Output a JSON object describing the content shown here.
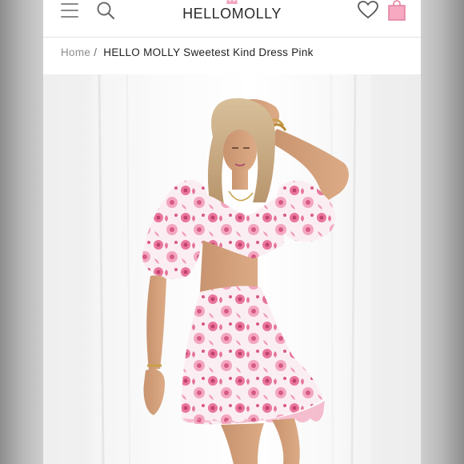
{
  "header": {
    "logo_text": "HELLOMOLLY",
    "icons": [
      "menu-icon",
      "search-icon",
      "crown-icon",
      "heart-icon",
      "shopping-bag-icon"
    ],
    "accent_color": "#f4a7bf"
  },
  "breadcrumb": {
    "home": "Home",
    "separator": "/",
    "current": "HELLO MOLLY Sweetest Kind Dress Pink"
  },
  "product_image": {
    "subject": "model wearing pink floral mini dress with puff sleeves",
    "dress_color": "#e0608a"
  }
}
